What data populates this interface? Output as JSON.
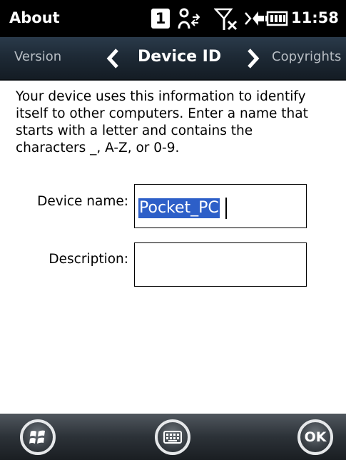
{
  "status_bar": {
    "app_title": "About",
    "notification_count": "1",
    "time": "11:58",
    "icons": [
      "notification-icon",
      "connectivity-icon",
      "no-signal-icon",
      "volume-icon",
      "battery-icon"
    ]
  },
  "tabs": {
    "previous": "Version",
    "current": "Device ID",
    "next": "Copyrights"
  },
  "content": {
    "description_lines": [
      "Your device uses this information to identify",
      "itself to other computers. Enter a name that",
      "starts with a letter and contains the",
      "characters _, A-Z, or 0-9."
    ],
    "device_name_label": "Device name:",
    "device_name_value": "Pocket_PC",
    "description_label": "Description:",
    "description_value": ""
  },
  "softkeys": {
    "start_icon": "windows-start-icon",
    "keyboard_icon": "keyboard-icon",
    "ok_label": "OK"
  },
  "colors": {
    "status_bar_bg": "#000000",
    "tab_bar_bg": "#1e2a36",
    "selection": "#2d5fc8",
    "softbar_bg": "#2c3238"
  }
}
